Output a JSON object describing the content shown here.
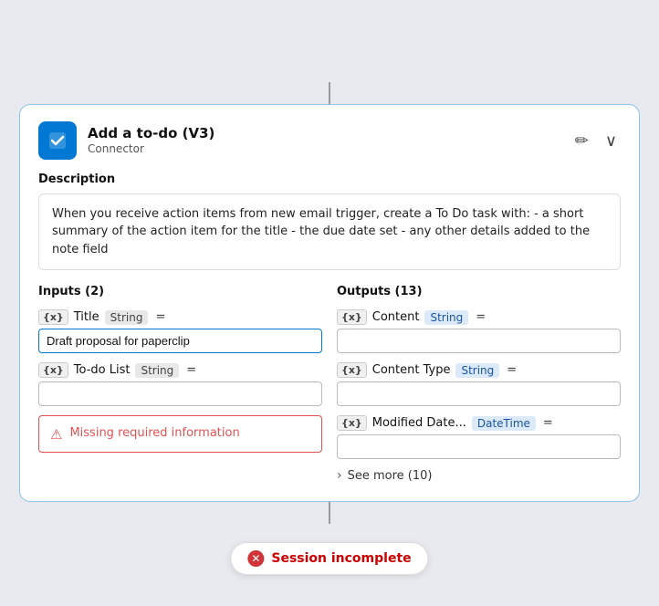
{
  "header": {
    "title": "Add a to-do (V3)",
    "subtitle": "Connector",
    "edit_icon": "✏",
    "collapse_icon": "∨"
  },
  "description": {
    "label": "Description",
    "text": "When you receive action items from new email trigger, create a To Do task with: - a short summary of the action item for the title - the due date set - any other details added to the note field"
  },
  "inputs": {
    "label": "Inputs (2)",
    "fields": [
      {
        "icon": "{x}",
        "name": "Title",
        "type": "String",
        "value": "Draft proposal for paperclip",
        "placeholder": ""
      },
      {
        "icon": "{x}",
        "name": "To-do List",
        "type": "String",
        "value": "",
        "placeholder": ""
      }
    ],
    "error": {
      "text": "Missing required information"
    }
  },
  "outputs": {
    "label": "Outputs (13)",
    "fields": [
      {
        "icon": "{x}",
        "name": "Content",
        "type": "String",
        "value": "",
        "placeholder": ""
      },
      {
        "icon": "{x}",
        "name": "Content Type",
        "type": "String",
        "value": "",
        "placeholder": ""
      },
      {
        "icon": "{x}",
        "name": "Modified Date...",
        "type": "DateTime",
        "value": "",
        "placeholder": ""
      }
    ],
    "see_more": "See more (10)"
  },
  "session_badge": {
    "text": "Session incomplete",
    "icon": "✕"
  }
}
